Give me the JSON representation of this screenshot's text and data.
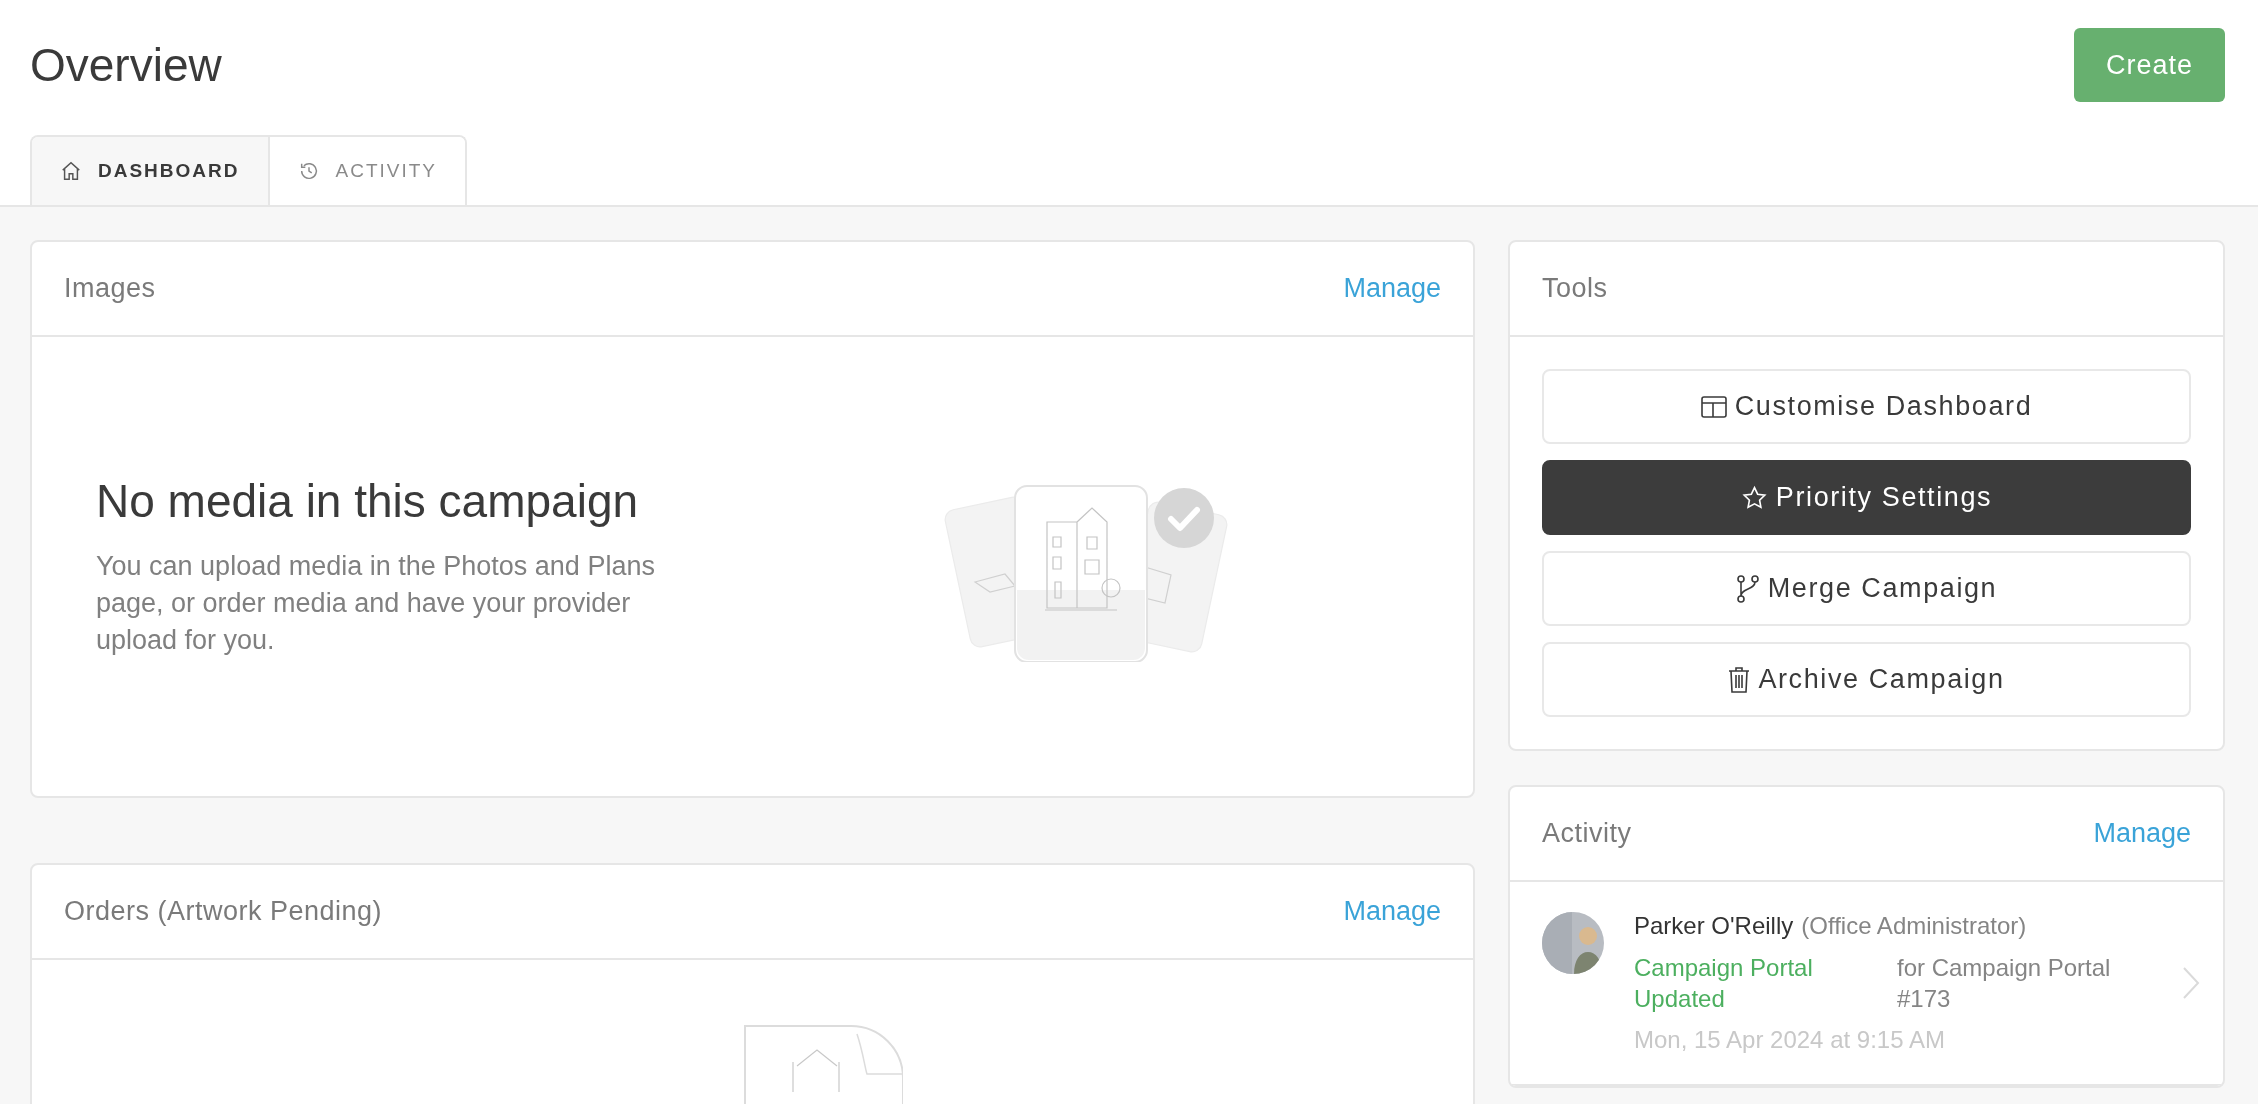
{
  "page": {
    "title": "Overview",
    "create_button": "Create"
  },
  "tabs": [
    {
      "label": "DASHBOARD",
      "selected": true
    },
    {
      "label": "ACTIVITY",
      "selected": false
    }
  ],
  "images_card": {
    "title": "Images",
    "action": "Manage",
    "empty_title": "No media in this campaign",
    "empty_text": "You can upload media in the Photos and Plans page, or order media and have your provider upload for you."
  },
  "orders_card": {
    "title": "Orders (Artwork Pending)",
    "action": "Manage"
  },
  "tools": {
    "title": "Tools",
    "buttons": [
      {
        "label": "Customise Dashboard",
        "primary": false
      },
      {
        "label": "Priority Settings",
        "primary": true
      },
      {
        "label": "Merge Campaign",
        "primary": false
      },
      {
        "label": "Archive Campaign",
        "primary": false
      }
    ]
  },
  "activity": {
    "title": "Activity",
    "action": "Manage",
    "items": [
      {
        "name": "Parker O'Reilly",
        "role": "(Office Administrator)",
        "event": "Campaign Portal Updated",
        "target": "for Campaign Portal #173",
        "time": "Mon, 15 Apr 2024 at 9:15 AM"
      }
    ]
  }
}
